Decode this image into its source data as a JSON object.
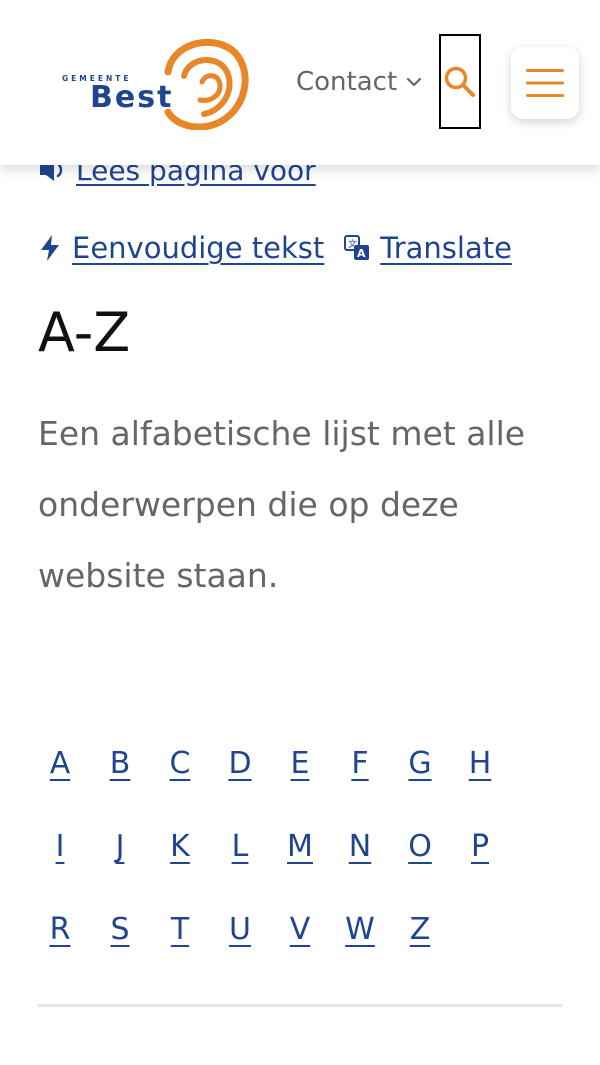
{
  "header": {
    "logo_small_text": "GEMEENTE",
    "logo_text": "Best",
    "contact_label": "Contact",
    "icons": {
      "contact_chevron": "chevron-down-icon",
      "search": "search-icon",
      "menu": "hamburger-menu-icon"
    }
  },
  "toolbar": {
    "read_aloud_label": "Lees pagina voor",
    "easy_text_label": "Eenvoudige tekst",
    "translate_label": "Translate",
    "icons": {
      "read_aloud": "speaker-icon",
      "easy_text": "lightning-icon",
      "translate": "translate-icon"
    }
  },
  "main": {
    "title": "A-Z",
    "intro": "Een alfabetische lijst met alle onderwerpen die op deze website staan."
  },
  "az_index": {
    "rows": [
      [
        "A",
        "B",
        "C",
        "D",
        "E",
        "F",
        "G",
        "H"
      ],
      [
        "I",
        "J",
        "K",
        "L",
        "M",
        "N",
        "O",
        "P"
      ],
      [
        "R",
        "S",
        "T",
        "U",
        "V",
        "W",
        "Z"
      ]
    ]
  },
  "colors": {
    "brand_blue": "#1f4591",
    "brand_orange": "#e8862a",
    "text_gray": "#666666",
    "heading": "#111111",
    "divider": "#e4e4e4"
  }
}
